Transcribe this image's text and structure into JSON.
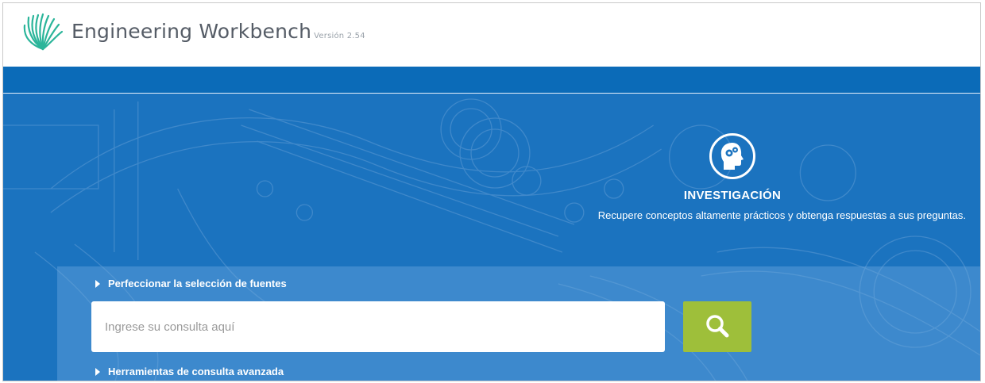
{
  "header": {
    "app_title": "Engineering Workbench",
    "version": "Versión 2.54",
    "logo_icon": "fan-logo-icon",
    "logo_color": "#2bb59a"
  },
  "navbar": {
    "color": "#0b6bb8"
  },
  "feature": {
    "icon": "head-gears-icon",
    "title": "INVESTIGACIÓN",
    "description": "Recupere conceptos altamente prácticos y obtenga respuestas a sus preguntas."
  },
  "search": {
    "refine_label": "Perfeccionar la selección de fuentes",
    "placeholder": "Ingrese su consulta aquí",
    "value": "",
    "button_icon": "search-icon",
    "button_color": "#9ebf3a",
    "advanced_label": "Herramientas de consulta avanzada"
  },
  "colors": {
    "hero_blue": "#1b73bf",
    "nav_blue": "#0b6bb8"
  }
}
